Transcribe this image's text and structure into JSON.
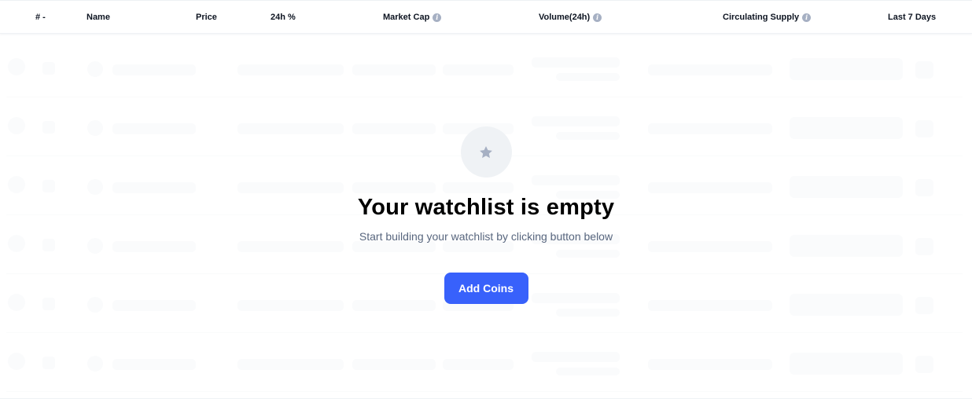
{
  "table": {
    "headers": {
      "rank": "# -",
      "name": "Name",
      "price": "Price",
      "change24h": "24h %",
      "market_cap": "Market Cap",
      "volume": "Volume(24h)",
      "supply": "Circulating Supply",
      "last7": "Last 7 Days"
    },
    "info_icon": "i"
  },
  "empty_state": {
    "icon": "star-icon",
    "title": "Your watchlist is empty",
    "subtitle": "Start building your watchlist by clicking button below",
    "button_label": "Add Coins"
  },
  "colors": {
    "accent": "#3861fb",
    "skeleton": "#f3f5f8",
    "icon_gray": "#a6b0c3"
  }
}
